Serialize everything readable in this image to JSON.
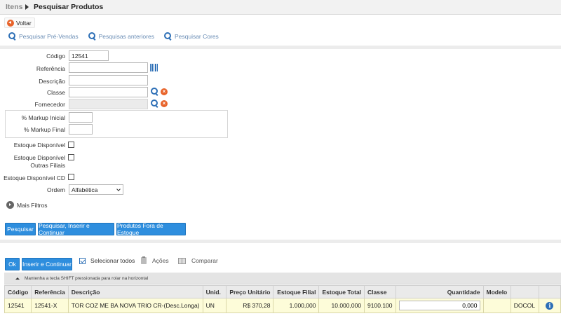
{
  "header": {
    "breadcrumb": "Itens",
    "title": "Pesquisar Produtos"
  },
  "back_label": "Voltar",
  "search_links": [
    "Pesquisar Pré-Vendas",
    "Pesquisas anteriores",
    "Pesquisar Cores"
  ],
  "form": {
    "codigo": {
      "label": "Código",
      "value": "12541"
    },
    "referencia": {
      "label": "Referência",
      "value": ""
    },
    "descricao": {
      "label": "Descrição",
      "value": ""
    },
    "classe": {
      "label": "Classe",
      "value": ""
    },
    "fornecedor": {
      "label": "Fornecedor",
      "value": ""
    },
    "markup_inicial": {
      "label": "% Markup Inicial",
      "value": ""
    },
    "markup_final": {
      "label": "% Markup Final",
      "value": ""
    },
    "estoque_disponivel": {
      "label": "Estoque Disponível",
      "checked": false
    },
    "estoque_outras_filiais": {
      "label_line1": "Estoque Disponível",
      "label_line2": "Outras Filiais",
      "checked": false
    },
    "estoque_cd": {
      "label": "Estoque Disponível CD",
      "checked": false
    },
    "ordem": {
      "label": "Ordem",
      "selected": "Alfabética"
    }
  },
  "mais_filtros": "Mais Filtros",
  "search_buttons": [
    "Pesquisar",
    "Pesquisar, Inserir e Continuar",
    "Produtos Fora de Estoque"
  ],
  "actions": {
    "ok": "Ok",
    "inserir": "Inserir e Continuar",
    "selecionar_todos": "Selecionar todos",
    "acoes": "Ações",
    "comparar": "Comparar"
  },
  "hint": "Mantenha a tecla SHIFT pressionada para rolar na horizontal",
  "table": {
    "columns": [
      "Código",
      "Referência",
      "Descrição",
      "Unid.",
      "Preço Unitário",
      "Estoque Filial",
      "Estoque Total",
      "Classe",
      "Quantidade",
      "Modelo",
      "",
      ""
    ],
    "rows": [
      {
        "codigo": "12541",
        "referencia": "12541-X",
        "descricao": "TOR COZ ME BA NOVA TRIO CR-(Desc.Longa)",
        "unid": "UN",
        "preco": "R$ 370,28",
        "estoque_filial": "1.000,000",
        "estoque_total": "10.000,000",
        "classe": "9100.100",
        "quantidade": "0,000",
        "modelo": "",
        "marca": "DOCOL"
      }
    ]
  },
  "colors": {
    "accent": "#2e8ede",
    "orange": "#e8632a",
    "row_highlight": "#fdfcd9"
  }
}
